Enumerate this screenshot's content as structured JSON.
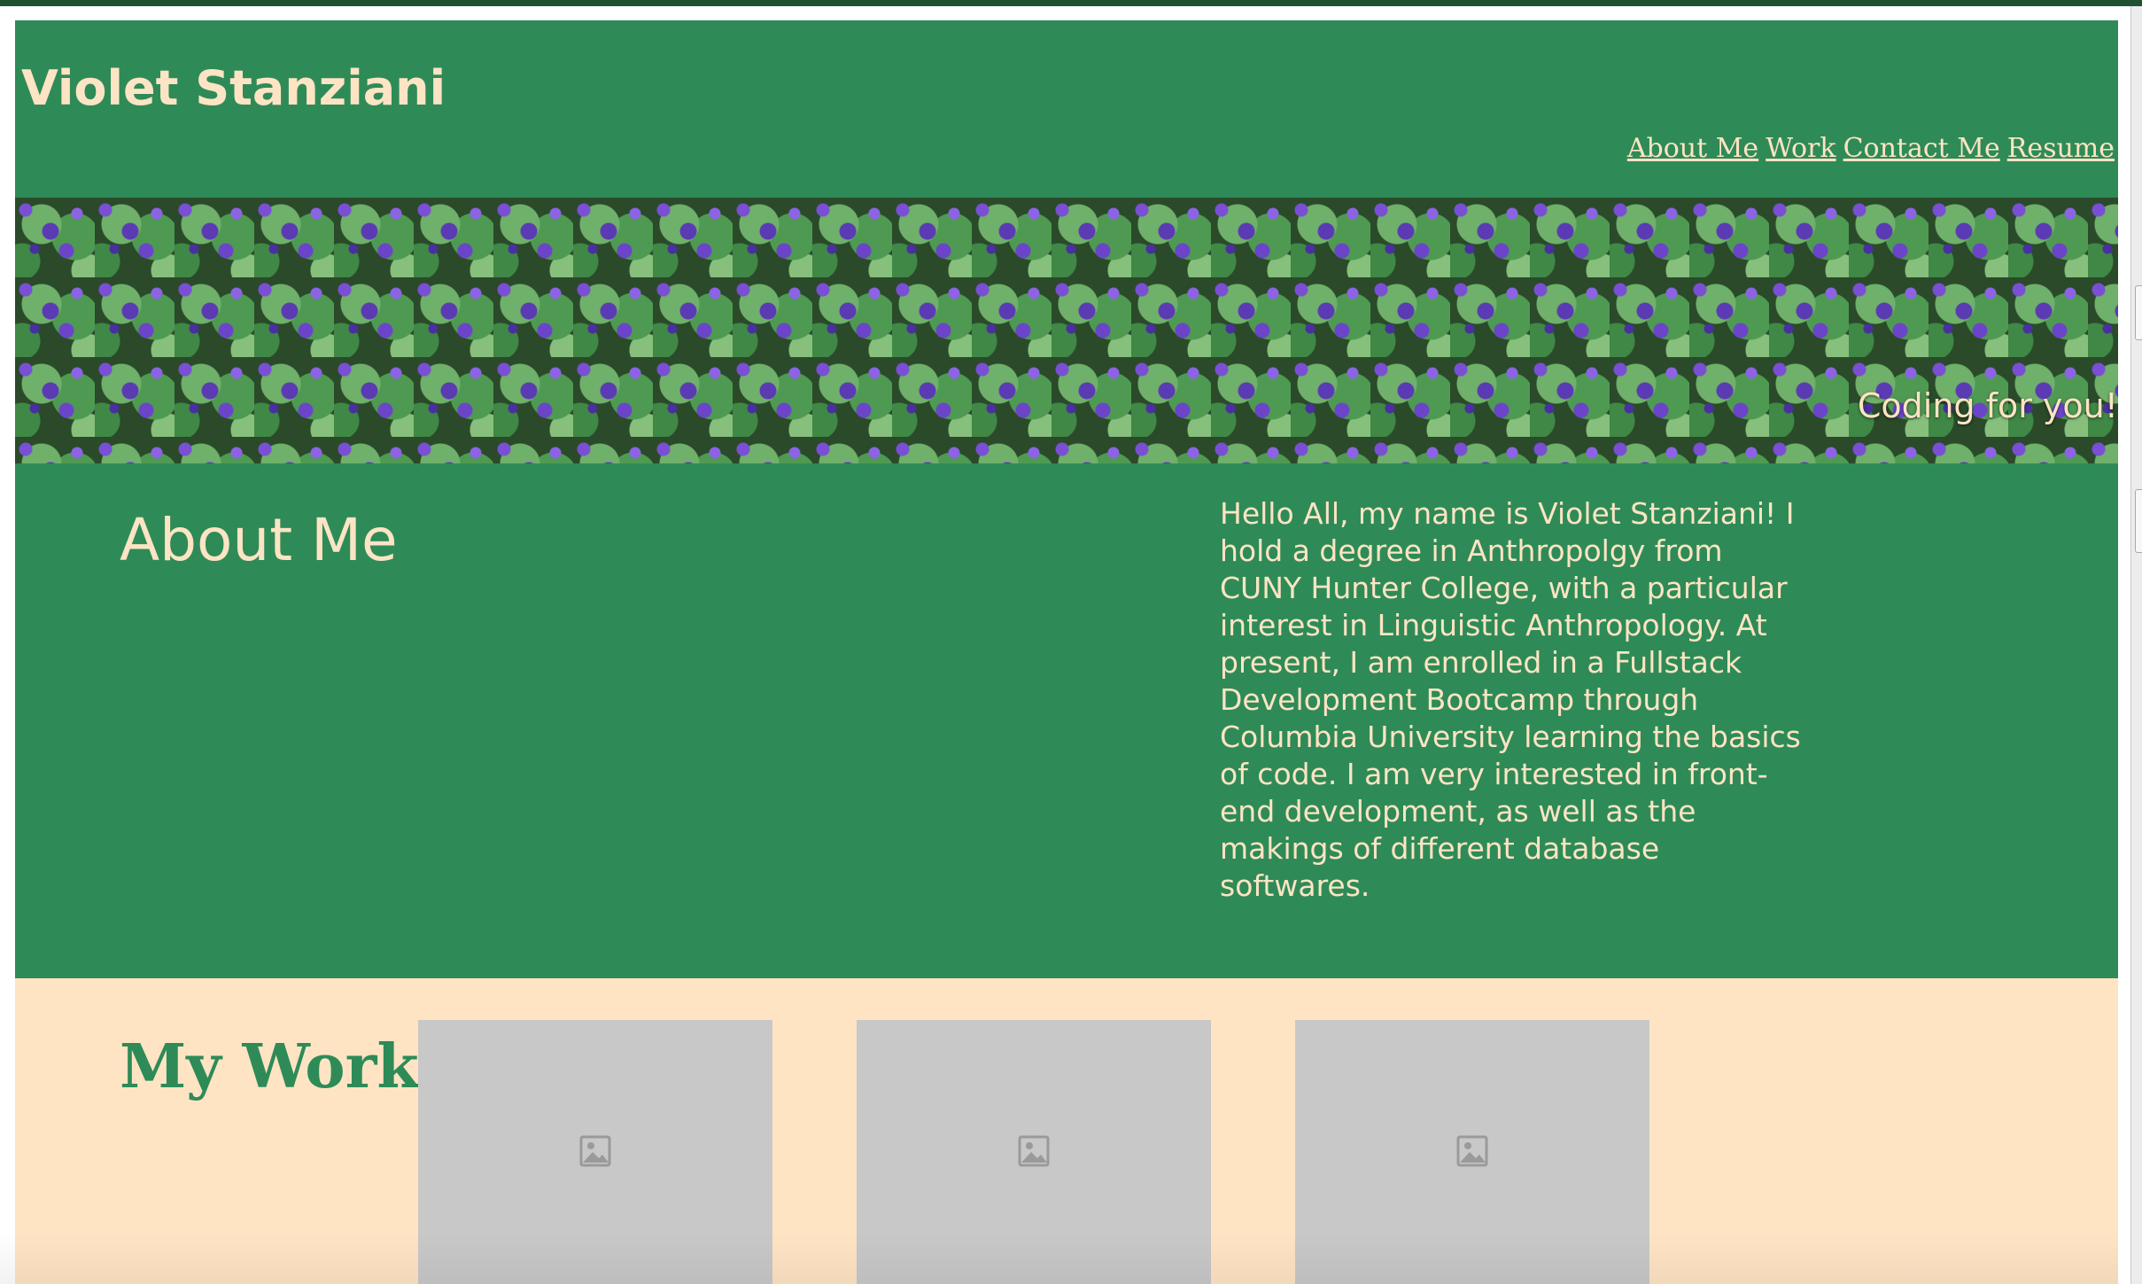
{
  "header": {
    "site_title": "Violet Stanziani",
    "nav": [
      {
        "label": "About Me"
      },
      {
        "label": "Work"
      },
      {
        "label": "Contact Me"
      },
      {
        "label": "Resume"
      }
    ]
  },
  "hero": {
    "tagline": "Coding for you!"
  },
  "about": {
    "heading": "About Me",
    "bio": "Hello All, my name is Violet Stanziani! I hold a degree in Anthropolgy from CUNY Hunter College, with a particular interest in Linguistic Anthropology. At present, I am enrolled in a Fullstack Development Bootcamp through Columbia University learning the basics of code. I am very interested in front-end development, as well as the makings of different database softwares."
  },
  "work": {
    "heading": "My Work",
    "projects": [
      {
        "icon": "broken-image-icon"
      },
      {
        "icon": "broken-image-icon"
      },
      {
        "icon": "broken-image-icon"
      }
    ]
  },
  "colors": {
    "header_green": "#2e8b57",
    "cream_text": "#fde4c4",
    "work_background": "#ffe4c4",
    "image_placeholder": "#c8c8c8"
  }
}
